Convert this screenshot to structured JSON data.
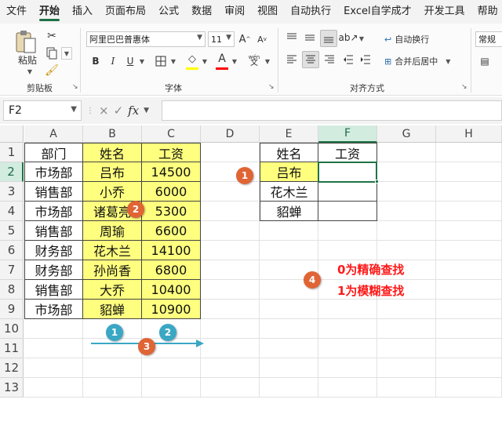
{
  "menu": [
    "文件",
    "开始",
    "插入",
    "页面布局",
    "公式",
    "数据",
    "审阅",
    "视图",
    "自动执行",
    "Excel自学成才",
    "开发工具",
    "帮助"
  ],
  "menu_active_index": 1,
  "ribbon": {
    "paste_label": "粘贴",
    "font_name": "阿里巴巴普惠体",
    "font_size": "11",
    "bold": "B",
    "italic": "I",
    "underline": "U",
    "phonetic": "wén",
    "wrap_text": "自动换行",
    "merge_center": "合并后居中",
    "number_format": "常规",
    "groups": {
      "clipboard": "剪贴板",
      "font": "字体",
      "alignment": "对齐方式"
    },
    "colors": {
      "highlight": "#ffff00",
      "font_color": "#ff0000"
    }
  },
  "formula_bar": {
    "name_box": "F2",
    "cancel_icon": "×",
    "enter_icon": "✓",
    "fx_label": "fx",
    "value": ""
  },
  "columns": [
    "A",
    "B",
    "C",
    "D",
    "E",
    "F",
    "G",
    "H"
  ],
  "selected_column": "F",
  "rows": [
    "1",
    "2",
    "3",
    "4",
    "5",
    "6",
    "7",
    "8",
    "9",
    "10",
    "11",
    "12",
    "13"
  ],
  "selected_row": "2",
  "cells": {
    "A1": "部门",
    "B1": "姓名",
    "C1": "工资",
    "A2": "市场部",
    "B2": "吕布",
    "C2": "14500",
    "A3": "销售部",
    "B3": "小乔",
    "C3": "6000",
    "A4": "市场部",
    "B4": "诸葛亮",
    "C4": "5300",
    "A5": "销售部",
    "B5": "周瑜",
    "C5": "6600",
    "A6": "财务部",
    "B6": "花木兰",
    "C6": "14100",
    "A7": "财务部",
    "B7": "孙尚香",
    "C7": "6800",
    "A8": "销售部",
    "B8": "大乔",
    "C8": "10400",
    "A9": "市场部",
    "B9": "貂蝉",
    "C9": "10900",
    "E1": "姓名",
    "F1": "工资",
    "E2": "吕布",
    "F2": "",
    "E3": "花木兰",
    "F3": "",
    "E4": "貂蝉",
    "F4": ""
  },
  "colors": {
    "yellow_fill": "#ffff7f",
    "excel_green": "#217346",
    "badge_orange": "#e06434",
    "badge_blue": "#3aa7c4",
    "note_red": "#ff1a1a"
  },
  "annotations": {
    "badge_e2": "1",
    "badge_b4": "2",
    "badge_blue_1": "1",
    "badge_blue_2": "2",
    "badge_arrow": "3",
    "badge_note": "4",
    "note_line1": "0为精确查找",
    "note_line2": "1为模糊查找"
  }
}
